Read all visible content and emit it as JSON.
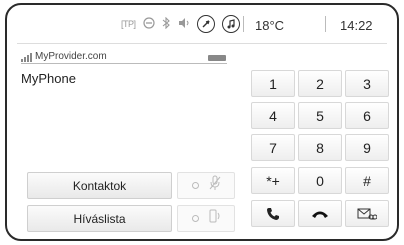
{
  "status_bar": {
    "icons": [
      "tp-icon",
      "no-entry-icon",
      "bluetooth-icon",
      "volume-icon",
      "navigation-icon",
      "music-icon"
    ],
    "tp_label": "TP",
    "temperature": "18°C",
    "time": "14:22"
  },
  "provider": {
    "name": "MyProvider.com",
    "phone_name": "MyPhone"
  },
  "keypad": {
    "keys": [
      "1",
      "2",
      "3",
      "4",
      "5",
      "6",
      "7",
      "8",
      "9",
      "*+",
      "0",
      "#"
    ],
    "call_icon": "phone-handset-icon",
    "hangup_icon": "hang-up-icon",
    "voicemail_icon": "voicemail-icon"
  },
  "buttons": {
    "contacts_label": "Kontaktok",
    "call_list_label": "Híváslista",
    "mute_icon": "mic-mute-icon",
    "handsfree_icon": "handsfree-icon"
  }
}
